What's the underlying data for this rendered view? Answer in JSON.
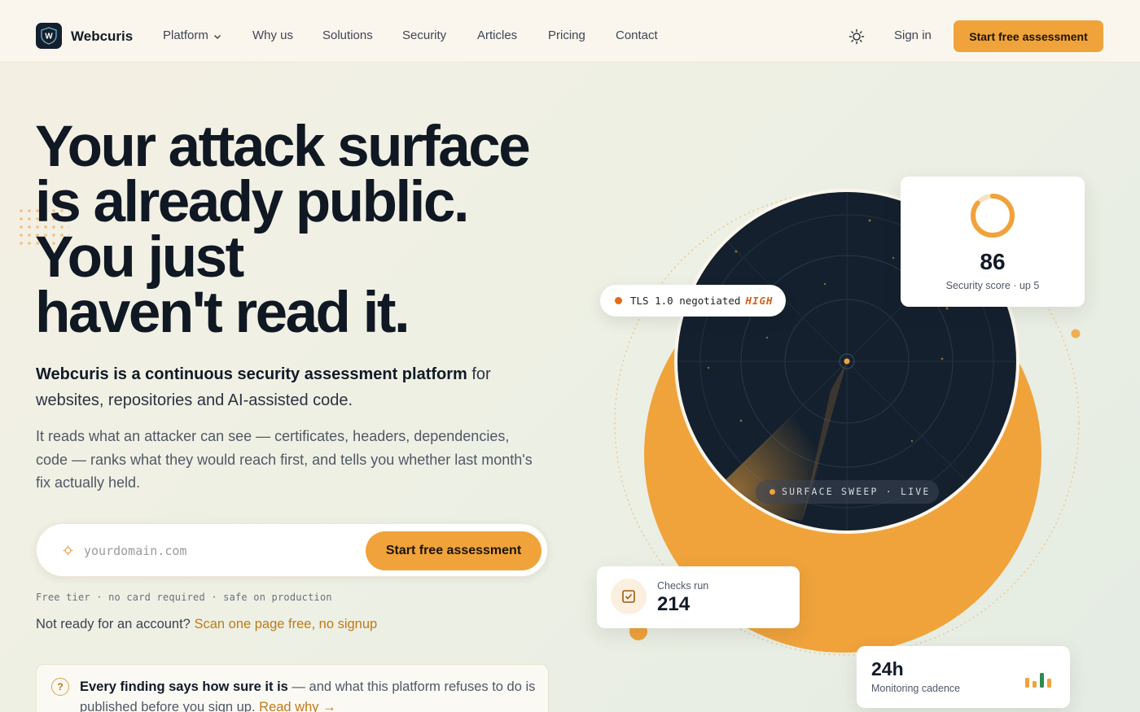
{
  "brand": {
    "name": "Webcuris",
    "logo_letter": "W"
  },
  "nav": {
    "items": [
      {
        "label": "Platform",
        "has_dropdown": true
      },
      {
        "label": "Why us"
      },
      {
        "label": "Solutions"
      },
      {
        "label": "Security"
      },
      {
        "label": "Articles"
      },
      {
        "label": "Pricing"
      },
      {
        "label": "Contact"
      }
    ],
    "sign_in": "Sign in",
    "cta": "Start free assessment",
    "theme_icon": "sun-icon"
  },
  "hero": {
    "headline_lines": [
      "Your attack surface",
      "is already public.",
      "You just",
      "haven't read it."
    ],
    "lead_bold": "Webcuris is a continuous security assessment platform",
    "lead_rest": " for websites, repositories and AI-assisted code.",
    "sub": "It reads what an attacker can see — certificates, headers, dependencies, code — ranks what they would reach first, and tells you whether last month's fix actually held.",
    "input_placeholder": "yourdomain.com",
    "input_icon": "target-icon",
    "cta": "Start free assessment",
    "fineprint": "Free tier · no card required · safe on production",
    "not_ready_text": "Not ready for an account? ",
    "not_ready_link": "Scan one page free, no signup",
    "notice_bold": "Every finding says how sure it is",
    "notice_rest": " — and what this platform refuses to do is published before you sign up. ",
    "notice_link": "Read why →"
  },
  "visual": {
    "score": {
      "value": "86",
      "label": "Security score · up 5",
      "ring_fill": 0.86
    },
    "finding": {
      "text": "TLS 1.0 negotiated",
      "severity": "HIGH"
    },
    "sweep": "SURFACE SWEEP · LIVE",
    "checks": {
      "label": "Checks run",
      "value": "214"
    },
    "cadence": {
      "value": "24h",
      "label": "Monitoring cadence"
    },
    "colors": {
      "accent": "#f0a33b",
      "radar": "#14202e",
      "severity": "#d2601a",
      "ok": "#2e8a4e"
    }
  }
}
